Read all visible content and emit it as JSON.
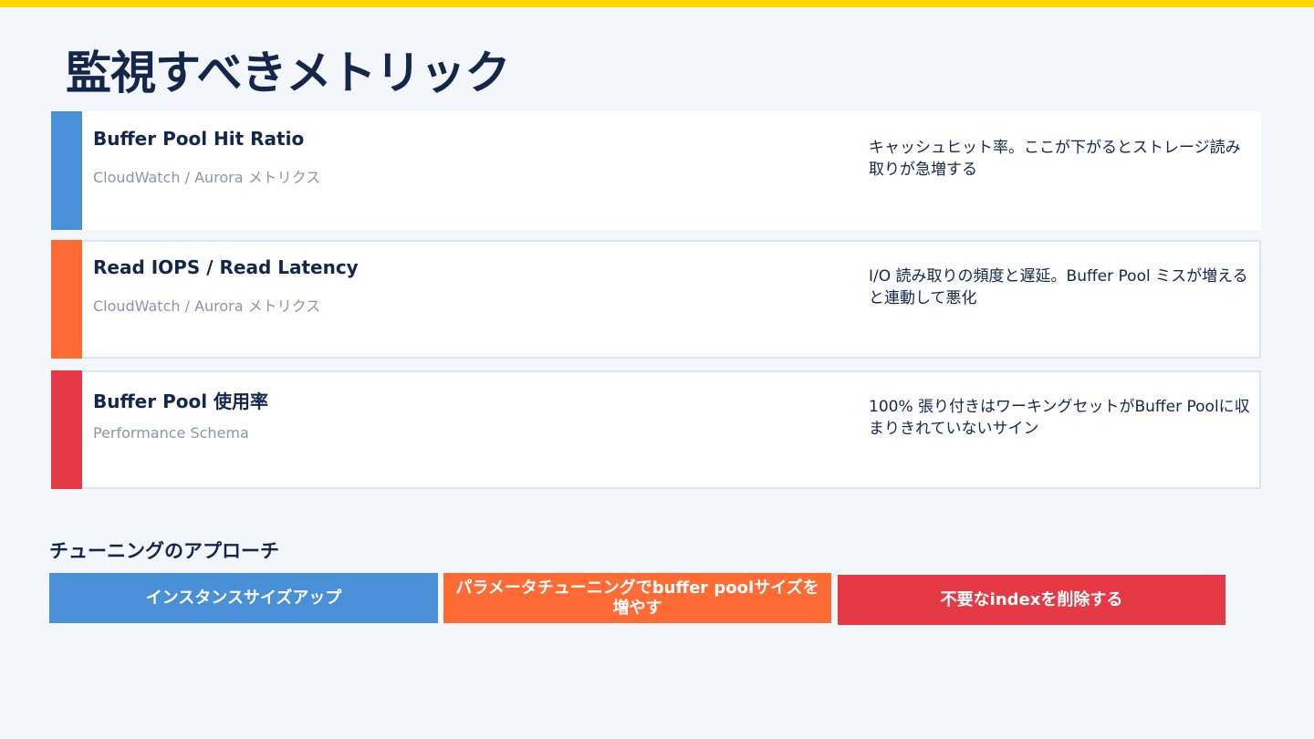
{
  "colors": {
    "top_bar": "#ffd500",
    "background": "#f3f6fb",
    "blue": "#4a90d9",
    "orange": "#ff6b35",
    "red": "#e63946",
    "navy": "#14264a"
  },
  "title": "監視すべきメトリック",
  "metrics": [
    {
      "name": "Buffer Pool Hit Ratio",
      "source": "CloudWatch / Aurora メトリクス",
      "description": "キャッシュヒット率。ここが下がるとストレージ読み取りが急増する",
      "color": "#4a90d9"
    },
    {
      "name": "Read IOPS / Read Latency",
      "source": "CloudWatch / Aurora メトリクス",
      "description": "I/O 読み取りの頻度と遅延。Buffer Pool ミスが増えると連動して悪化",
      "color": "#ff6b35"
    },
    {
      "name": "Buffer Pool 使用率",
      "source": "Performance Schema",
      "description": "100% 張り付きはワーキングセットがBuffer Poolに収まりきれていないサイン",
      "color": "#e63946"
    }
  ],
  "tuning": {
    "heading": "チューニングのアプローチ",
    "approaches": [
      {
        "label": "インスタンスサイズアップ",
        "color": "#4a90d9"
      },
      {
        "label": "パラメータチューニングでbuffer poolサイズを増やす",
        "color": "#ff6b35"
      },
      {
        "label": "不要なindexを削除する",
        "color": "#e63946"
      }
    ]
  }
}
